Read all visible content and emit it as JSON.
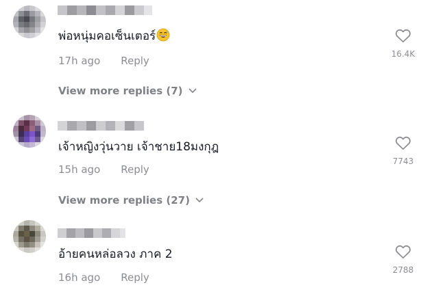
{
  "comments": [
    {
      "text": "พ่อหนุ่มคอเซ็นเตอร์",
      "emoji": "grinning-sweat-emoji",
      "time": "17h ago",
      "reply_label": "Reply",
      "likes": "16.4K",
      "view_more": "View more replies (7)"
    },
    {
      "text": "เจ้าหญิงวุ่นวาย เจ้าชาย18มงกุฎ",
      "time": "15h ago",
      "reply_label": "Reply",
      "likes": "7743",
      "view_more": "View more replies (27)"
    },
    {
      "text": "อ้ายคนหล่อลวง ภาค 2",
      "time": "16h ago",
      "reply_label": "Reply",
      "likes": "2788"
    }
  ],
  "icons": {
    "like": "heart-outline-icon",
    "expand": "chevron-down-icon"
  },
  "colors": {
    "text_primary": "#161823",
    "text_secondary": "#8a8b91"
  }
}
